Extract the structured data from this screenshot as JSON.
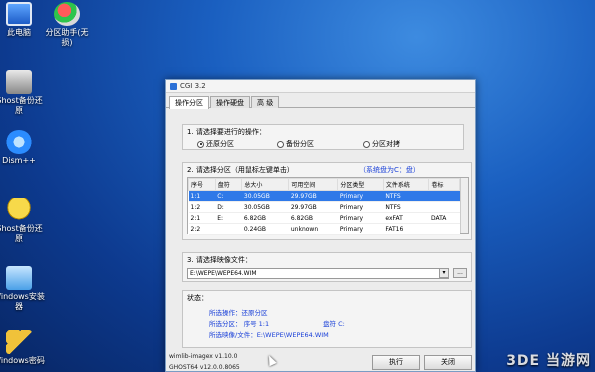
{
  "desktop": {
    "icons": [
      {
        "name": "computer-icon",
        "label": "此电脑"
      },
      {
        "name": "partition-tool-icon",
        "label": "分区助手(无损)"
      },
      {
        "name": "ghost-restore-icon",
        "label": "Ghost备份还原"
      },
      {
        "name": "dism-icon",
        "label": "Dism++"
      },
      {
        "name": "ghost-backup-icon",
        "label": "Ghost备份还原"
      },
      {
        "name": "windows-installer-icon",
        "label": "Windows安装器"
      },
      {
        "name": "windows-password-icon",
        "label": "Windows密码"
      }
    ]
  },
  "window": {
    "title": "CGI 3.2",
    "tabs": [
      "操作分区",
      "操作硬盘",
      "高 级"
    ],
    "step1": {
      "title": "1. 请选择要进行的操作：",
      "options": [
        "还原分区",
        "备份分区",
        "分区对拷"
      ],
      "selected": 0
    },
    "step2": {
      "title": "2. 请选择分区（用鼠标左键单击）",
      "show_hidden": "（系统盘为C：盘）",
      "columns": [
        "序号",
        "盘符",
        "总大小",
        "可用空间",
        "分区类型",
        "文件系统",
        "卷标"
      ],
      "rows": [
        [
          "1:1",
          "C:",
          "30.05GB",
          "29.97GB",
          "Primary",
          "NTFS",
          ""
        ],
        [
          "1:2",
          "D:",
          "30.05GB",
          "29.97GB",
          "Primary",
          "NTFS",
          ""
        ],
        [
          "2:1",
          "E:",
          "6.82GB",
          "6.82GB",
          "Primary",
          "exFAT",
          "DATA"
        ],
        [
          "2:2",
          "",
          "0.24GB",
          "unknown",
          "Primary",
          "FAT16",
          ""
        ]
      ],
      "selected_row": 0
    },
    "step3": {
      "title": "3. 请选择映像文件：",
      "path": "E:\\WEPE\\WEPE64.WIM",
      "browse": "..."
    },
    "status": {
      "title": "状态：",
      "lines": [
        {
          "label": "所选操作：还原分区",
          "extra": ""
        },
        {
          "label": "所选分区：  序号 1:1",
          "extra": "盘符 C:"
        },
        {
          "label": "所选映像/文件：E:\\WEPE\\WEPE64.WIM",
          "extra": ""
        }
      ]
    },
    "footer": {
      "version1": "wimlib-imagex v1.10.0",
      "version2": "GHOST64 v12.0.0.8065"
    },
    "buttons": {
      "execute": "执行",
      "close": "关闭"
    }
  },
  "watermark": "3DE 当游网"
}
